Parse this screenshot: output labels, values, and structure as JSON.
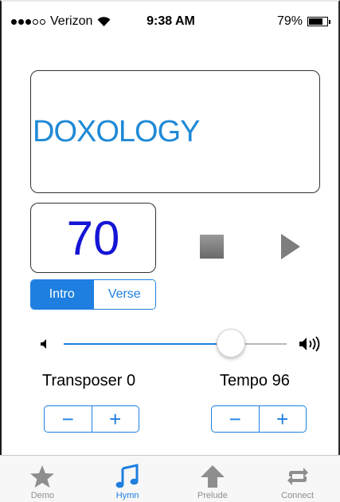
{
  "status_bar": {
    "carrier": "Verizon",
    "signal_bars_filled": 3,
    "signal_bars_total": 5,
    "time": "9:38 AM",
    "battery_percent_text": "79%",
    "battery_level": 0.79
  },
  "hymn": {
    "title": "DOXOLOGY",
    "number": "70"
  },
  "playback": {
    "stop_icon": "stop-icon",
    "play_icon": "play-icon"
  },
  "section_selector": {
    "options": [
      "Intro",
      "Verse"
    ],
    "selected": "Intro"
  },
  "volume": {
    "level": 0.75,
    "min_icon": "speaker-low-icon",
    "max_icon": "speaker-high-icon"
  },
  "transposer": {
    "label": "Transposer 0",
    "minus": "−",
    "plus": "+"
  },
  "tempo": {
    "label": "Tempo 96",
    "minus": "−",
    "plus": "+"
  },
  "tabs": [
    {
      "label": "Demo",
      "icon": "star-icon",
      "active": false
    },
    {
      "label": "Hymn",
      "icon": "music-note-icon",
      "active": true
    },
    {
      "label": "Prelude",
      "icon": "up-arrow-icon",
      "active": false
    },
    {
      "label": "Connect",
      "icon": "repeat-icon",
      "active": false
    }
  ],
  "colors": {
    "accent": "#1e7fe0",
    "title_text": "#1f8ad6",
    "number_text": "#1515d6",
    "inactive_tab": "#8e8e8e"
  }
}
